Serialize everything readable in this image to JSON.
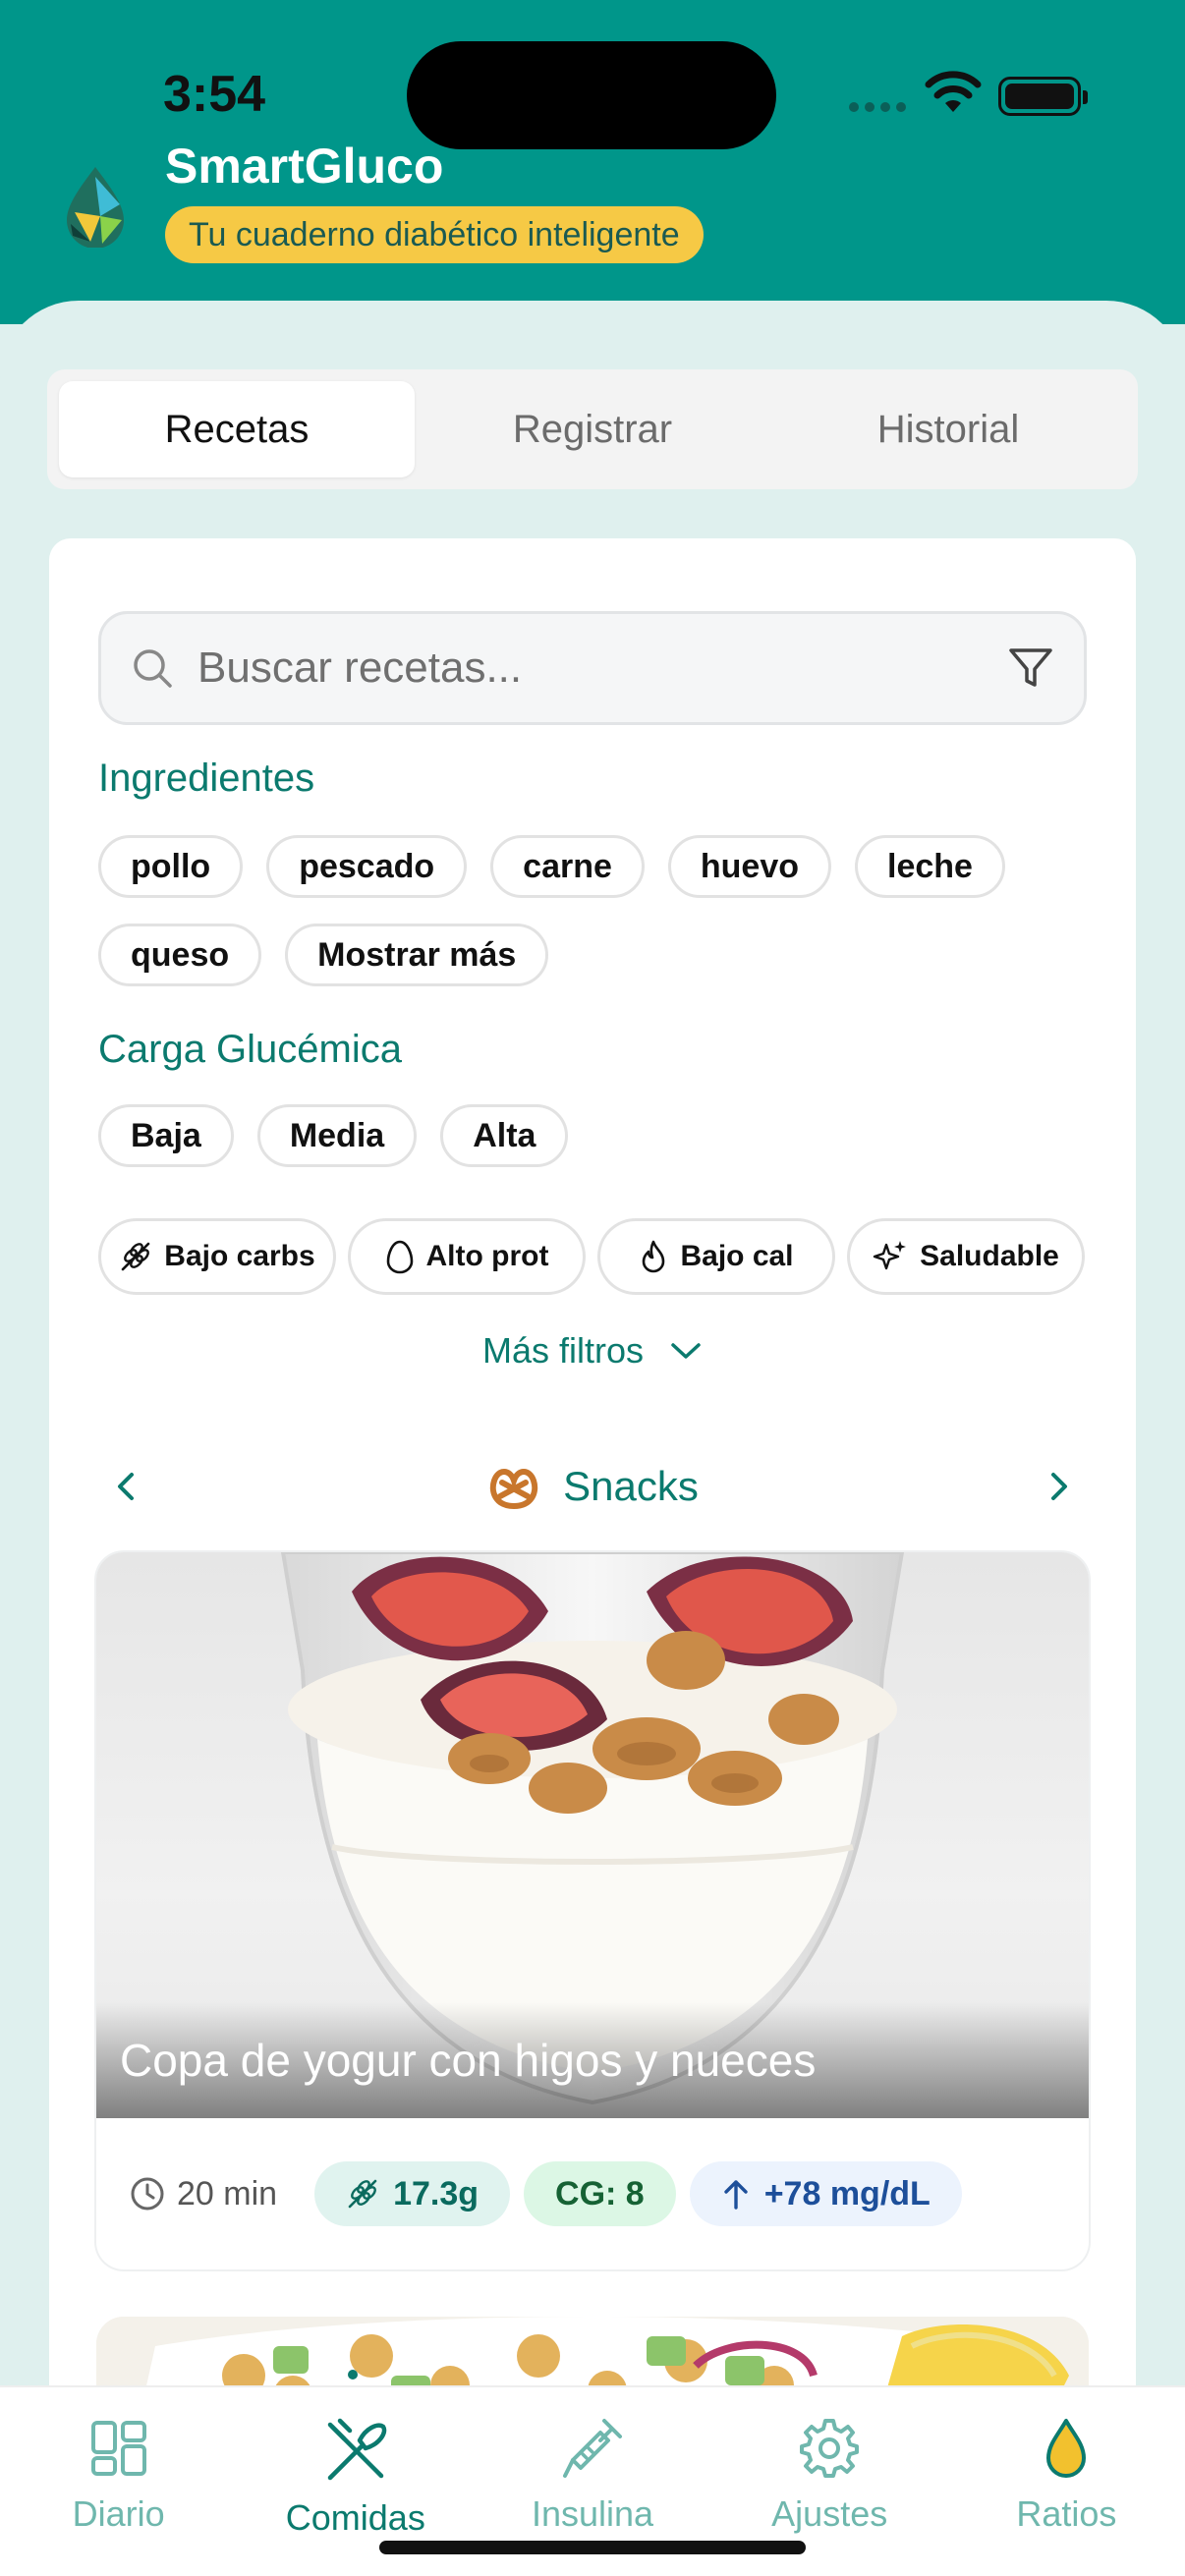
{
  "status": {
    "time": "3:54"
  },
  "app": {
    "title": "SmartGluco",
    "tagline": "Tu cuaderno diabético inteligente"
  },
  "tabs": [
    {
      "label": "Recetas",
      "active": true
    },
    {
      "label": "Registrar",
      "active": false
    },
    {
      "label": "Historial",
      "active": false
    }
  ],
  "search": {
    "placeholder": "Buscar recetas..."
  },
  "ingredients": {
    "label": "Ingredientes",
    "chips": [
      "pollo",
      "pescado",
      "carne",
      "huevo",
      "leche",
      "queso",
      "Mostrar más"
    ]
  },
  "glycemic": {
    "label": "Carga Glucémica",
    "chips": [
      "Baja",
      "Media",
      "Alta"
    ]
  },
  "quick_filters": [
    {
      "label": "Bajo carbs",
      "icon": "wheat-icon"
    },
    {
      "label": "Alto prot",
      "icon": "egg-icon"
    },
    {
      "label": "Bajo cal",
      "icon": "flame-icon"
    },
    {
      "label": "Saludable",
      "icon": "sparkles-icon"
    }
  ],
  "more_filters_label": "Más filtros",
  "category": {
    "name": "Snacks",
    "icon": "pretzel-icon"
  },
  "recipe": {
    "title": "Copa de yogur con higos y nueces",
    "time": "20 min",
    "carbs": "17.3g",
    "cg": "CG: 8",
    "glucose_rise": "+78 mg/dL"
  },
  "bottom_nav": [
    {
      "label": "Diario",
      "icon": "grid-icon",
      "active": false
    },
    {
      "label": "Comidas",
      "icon": "utensils-icon",
      "active": true
    },
    {
      "label": "Insulina",
      "icon": "syringe-icon",
      "active": false
    },
    {
      "label": "Ajustes",
      "icon": "gear-icon",
      "active": false
    },
    {
      "label": "Ratios",
      "icon": "drop-icon",
      "active": false
    }
  ],
  "colors": {
    "primary": "#00968a",
    "accent": "#f6c945",
    "text_teal": "#0b7a6e"
  }
}
